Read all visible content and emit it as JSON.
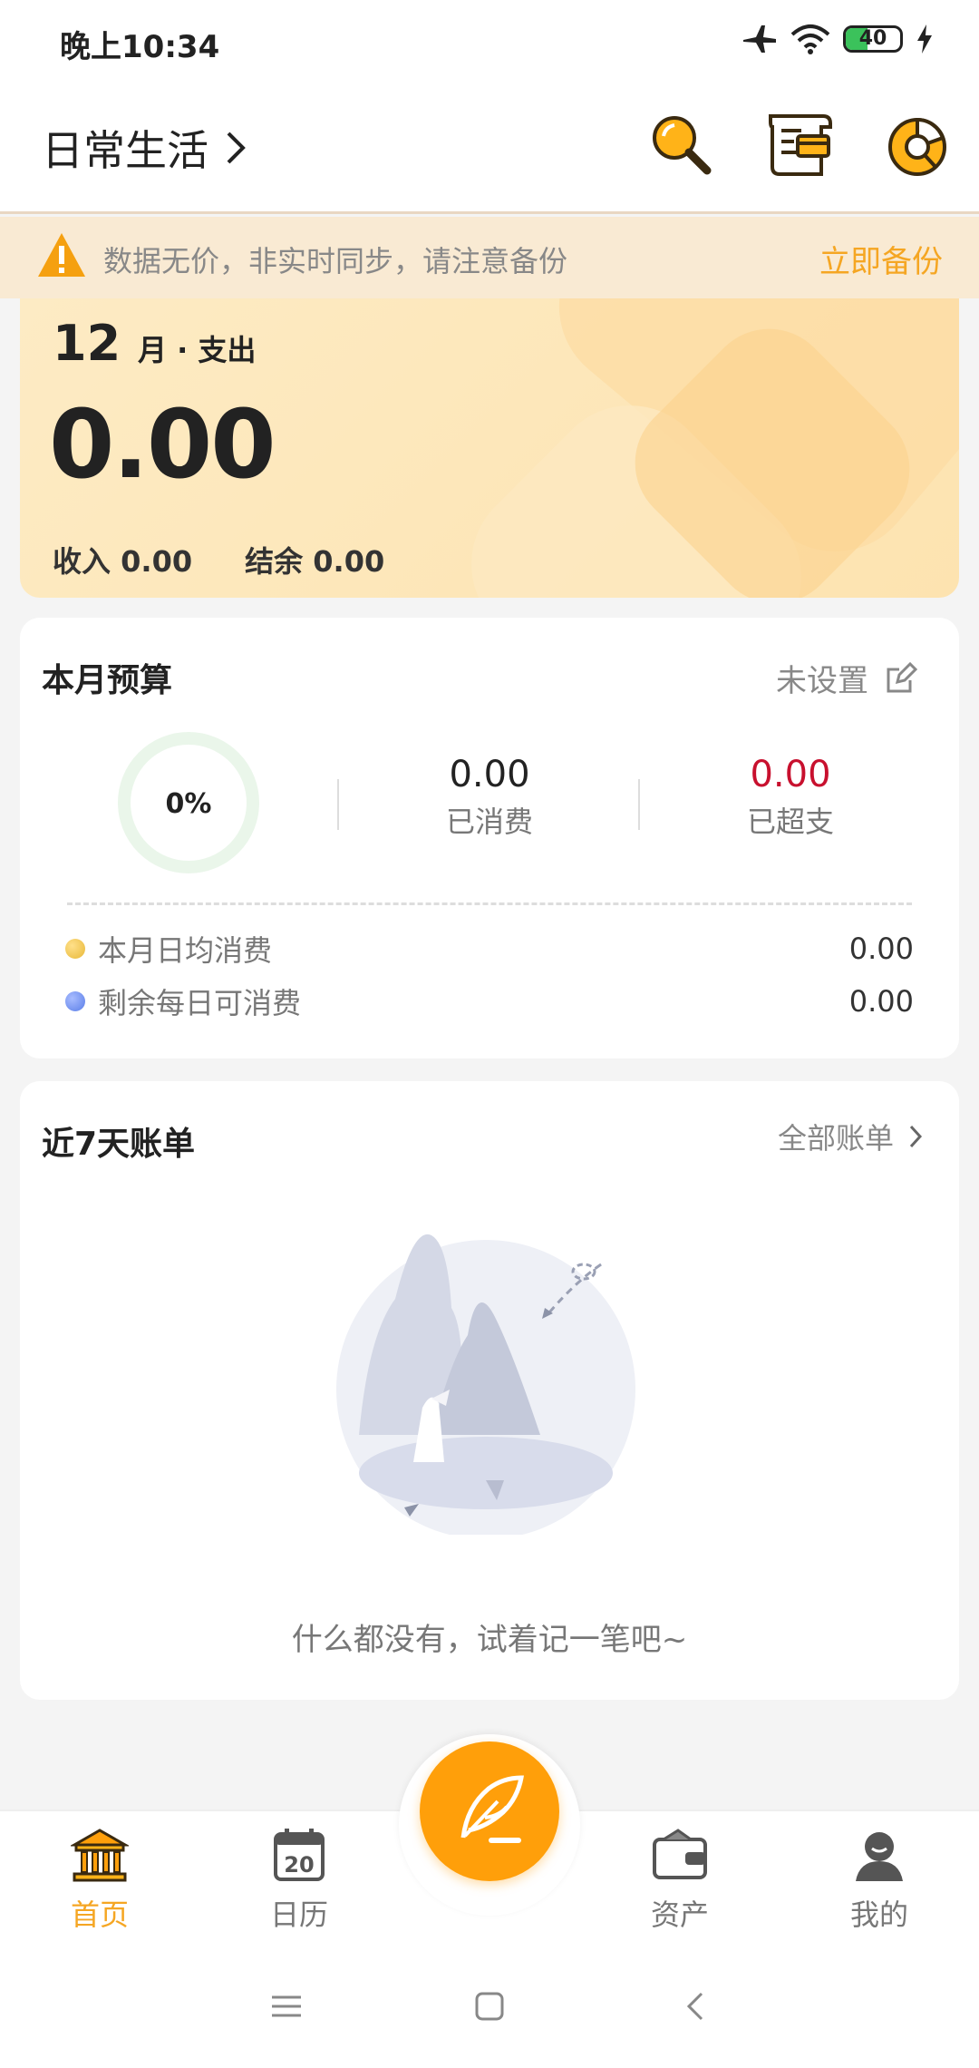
{
  "status_bar": {
    "time": "晚上10:34",
    "battery": "40"
  },
  "header": {
    "book_name": "日常生活"
  },
  "banner": {
    "message": "数据无价，非实时同步，请注意备份",
    "action": "立即备份"
  },
  "summary": {
    "month": "12",
    "month_suffix": "月 · 支出",
    "expense": "0.00",
    "income_label": "收入",
    "income": "0.00",
    "balance_label": "结余",
    "balance": "0.00"
  },
  "budget": {
    "title": "本月预算",
    "unset_label": "未设置",
    "percent": "0%",
    "spent_value": "0.00",
    "spent_label": "已消费",
    "over_value": "0.00",
    "over_label": "已超支",
    "daily_avg_label": "本月日均消费",
    "daily_avg_value": "0.00",
    "remaining_daily_label": "剩余每日可消费",
    "remaining_daily_value": "0.00",
    "colors": {
      "over": "#c8102e",
      "dot_avg": "#f0c24a",
      "dot_remain": "#6c8cf0"
    }
  },
  "recent_bills": {
    "title": "近7天账单",
    "more_label": "全部账单",
    "empty_message": "什么都没有，试着记一笔吧~"
  },
  "tabs": [
    {
      "label": "首页",
      "icon": "bank-icon",
      "active": true
    },
    {
      "label": "日历",
      "icon": "calendar-icon",
      "active": false
    },
    {
      "label": "资产",
      "icon": "wallet-icon",
      "active": false
    },
    {
      "label": "我的",
      "icon": "user-icon",
      "active": false
    }
  ],
  "calendar_day": "20",
  "accent_color": "#ff9f0a"
}
